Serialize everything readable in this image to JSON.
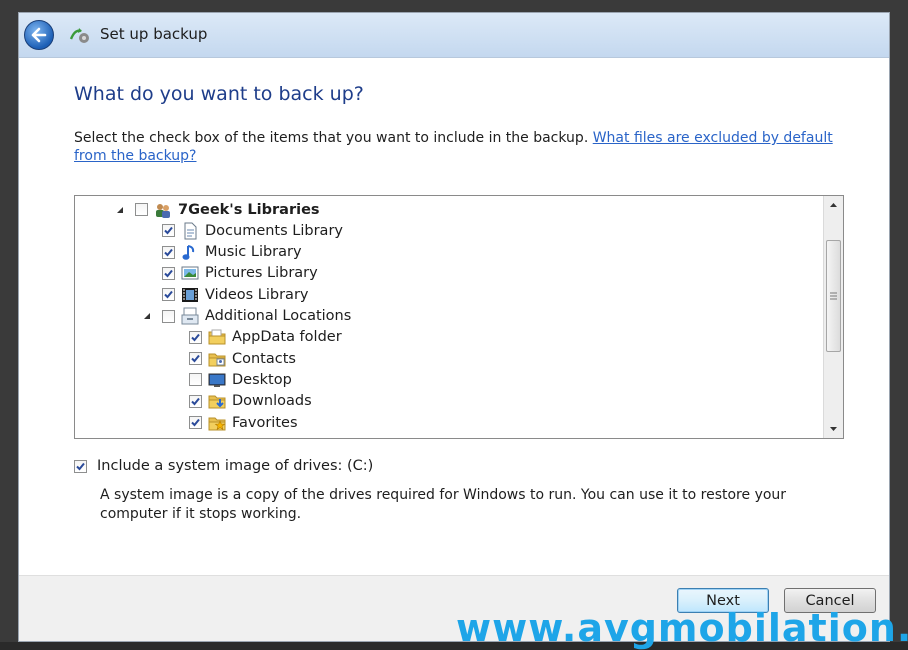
{
  "window": {
    "title": "Set up backup"
  },
  "page": {
    "heading": "What do you want to back up?",
    "instruction": "Select the check box of the items that you want to include in the backup. ",
    "instruction_link": "What files are excluded by default from the backup?"
  },
  "tree": {
    "items": [
      {
        "label": "7Geek's Libraries",
        "checked": false,
        "expanded": true,
        "bold": true,
        "icon": "users-libraries-icon"
      },
      {
        "label": "Documents Library",
        "checked": true,
        "icon": "document-icon"
      },
      {
        "label": "Music Library",
        "checked": true,
        "icon": "music-note-icon"
      },
      {
        "label": "Pictures Library",
        "checked": true,
        "icon": "picture-icon"
      },
      {
        "label": "Videos Library",
        "checked": true,
        "icon": "film-strip-icon"
      },
      {
        "label": "Additional Locations",
        "checked": false,
        "expanded": true,
        "icon": "locations-icon"
      },
      {
        "label": "AppData folder",
        "checked": true,
        "icon": "folder-icon"
      },
      {
        "label": "Contacts",
        "checked": true,
        "icon": "contacts-folder-icon"
      },
      {
        "label": "Desktop",
        "checked": false,
        "icon": "desktop-icon"
      },
      {
        "label": "Downloads",
        "checked": true,
        "icon": "downloads-folder-icon"
      },
      {
        "label": "Favorites",
        "checked": true,
        "icon": "favorites-folder-icon"
      }
    ]
  },
  "system_image": {
    "label": "Include a system image of drives: (C:)",
    "checked": true,
    "description": "A system image is a copy of the drives required for Windows to run. You can use it to restore your computer if it stops working."
  },
  "footer": {
    "next_label": "Next",
    "cancel_label": "Cancel"
  },
  "watermark": {
    "text": "www.avgmobilation."
  },
  "colors": {
    "heading": "#1e3d8a",
    "link": "#2a64c8",
    "watermark": "#1ea5e8"
  }
}
